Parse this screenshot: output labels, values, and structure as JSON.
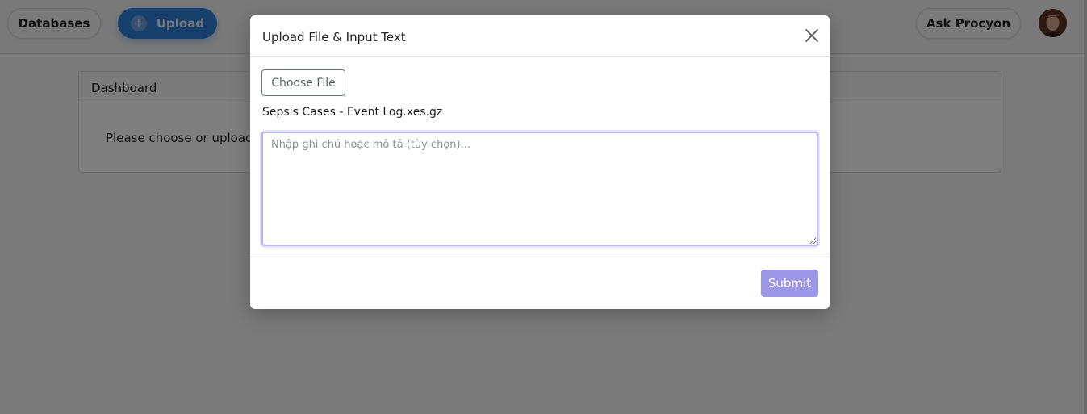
{
  "topbar": {
    "databases_label": "Databases",
    "upload_label": "Upload",
    "upload_icon": "+",
    "ask_label": "Ask Procyon"
  },
  "dashboard": {
    "header": "Dashboard",
    "message": "Please choose or upload a"
  },
  "modal": {
    "title": "Upload File & Input Text",
    "choose_file_label": "Choose File",
    "selected_file": "Sepsis Cases - Event Log.xes.gz",
    "note_placeholder": "Nhập ghi chú hoặc mô tả (tùy chọn)...",
    "note_value": "",
    "submit_label": "Submit"
  },
  "colors": {
    "primary": "#2f7fd6",
    "submit": "#9c96e6",
    "focus_border": "#b9b4f3"
  }
}
